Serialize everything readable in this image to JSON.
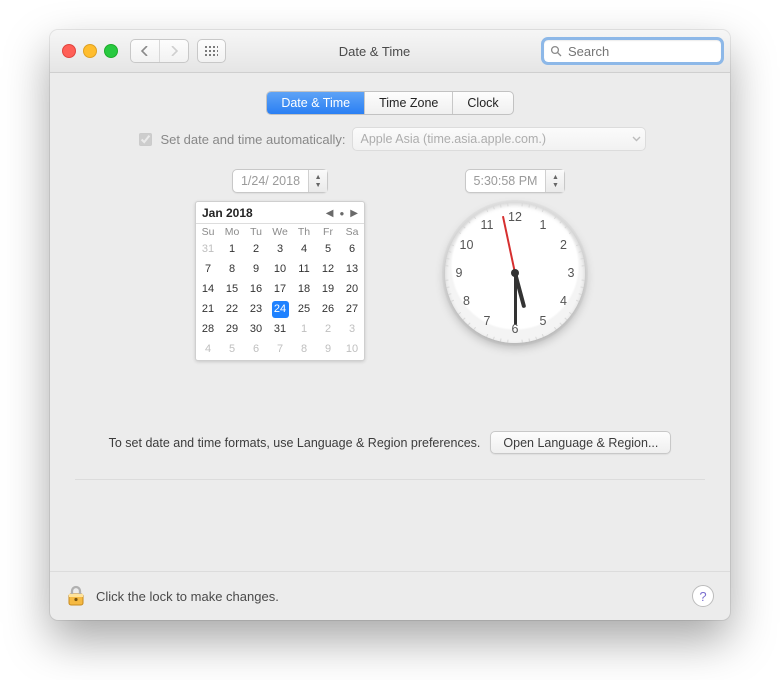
{
  "window": {
    "title": "Date & Time"
  },
  "search": {
    "placeholder": "Search"
  },
  "tabs": [
    "Date & Time",
    "Time Zone",
    "Clock"
  ],
  "activeTab": 0,
  "auto": {
    "checked": true,
    "label": "Set date and time automatically:",
    "server": "Apple Asia (time.asia.apple.com.)"
  },
  "dateField": "1/24/ 2018",
  "timeField": "5:30:58 PM",
  "calendar": {
    "monthLabel": "Jan 2018",
    "dow": [
      "Su",
      "Mo",
      "Tu",
      "We",
      "Th",
      "Fr",
      "Sa"
    ],
    "grid": [
      [
        {
          "d": 31,
          "o": 1
        },
        {
          "d": 1
        },
        {
          "d": 2
        },
        {
          "d": 3
        },
        {
          "d": 4
        },
        {
          "d": 5
        },
        {
          "d": 6
        }
      ],
      [
        {
          "d": 7
        },
        {
          "d": 8
        },
        {
          "d": 9
        },
        {
          "d": 10
        },
        {
          "d": 11
        },
        {
          "d": 12
        },
        {
          "d": 13
        }
      ],
      [
        {
          "d": 14
        },
        {
          "d": 15
        },
        {
          "d": 16
        },
        {
          "d": 17
        },
        {
          "d": 18
        },
        {
          "d": 19
        },
        {
          "d": 20
        }
      ],
      [
        {
          "d": 21
        },
        {
          "d": 22
        },
        {
          "d": 23
        },
        {
          "d": 24,
          "s": 1
        },
        {
          "d": 25
        },
        {
          "d": 26
        },
        {
          "d": 27
        }
      ],
      [
        {
          "d": 28
        },
        {
          "d": 29
        },
        {
          "d": 30
        },
        {
          "d": 31
        },
        {
          "d": 1,
          "o": 1
        },
        {
          "d": 2,
          "o": 1
        },
        {
          "d": 3,
          "o": 1
        }
      ],
      [
        {
          "d": 4,
          "o": 1
        },
        {
          "d": 5,
          "o": 1
        },
        {
          "d": 6,
          "o": 1
        },
        {
          "d": 7,
          "o": 1
        },
        {
          "d": 8,
          "o": 1
        },
        {
          "d": 9,
          "o": 1
        },
        {
          "d": 10,
          "o": 1
        }
      ]
    ]
  },
  "clock": {
    "hour": 5,
    "minute": 30,
    "second": 58,
    "numerals": [
      12,
      1,
      2,
      3,
      4,
      5,
      6,
      7,
      8,
      9,
      10,
      11
    ]
  },
  "hint": {
    "text": "To set date and time formats, use Language & Region preferences.",
    "button": "Open Language & Region..."
  },
  "footer": {
    "lockText": "Click the lock to make changes.",
    "help": "?"
  }
}
